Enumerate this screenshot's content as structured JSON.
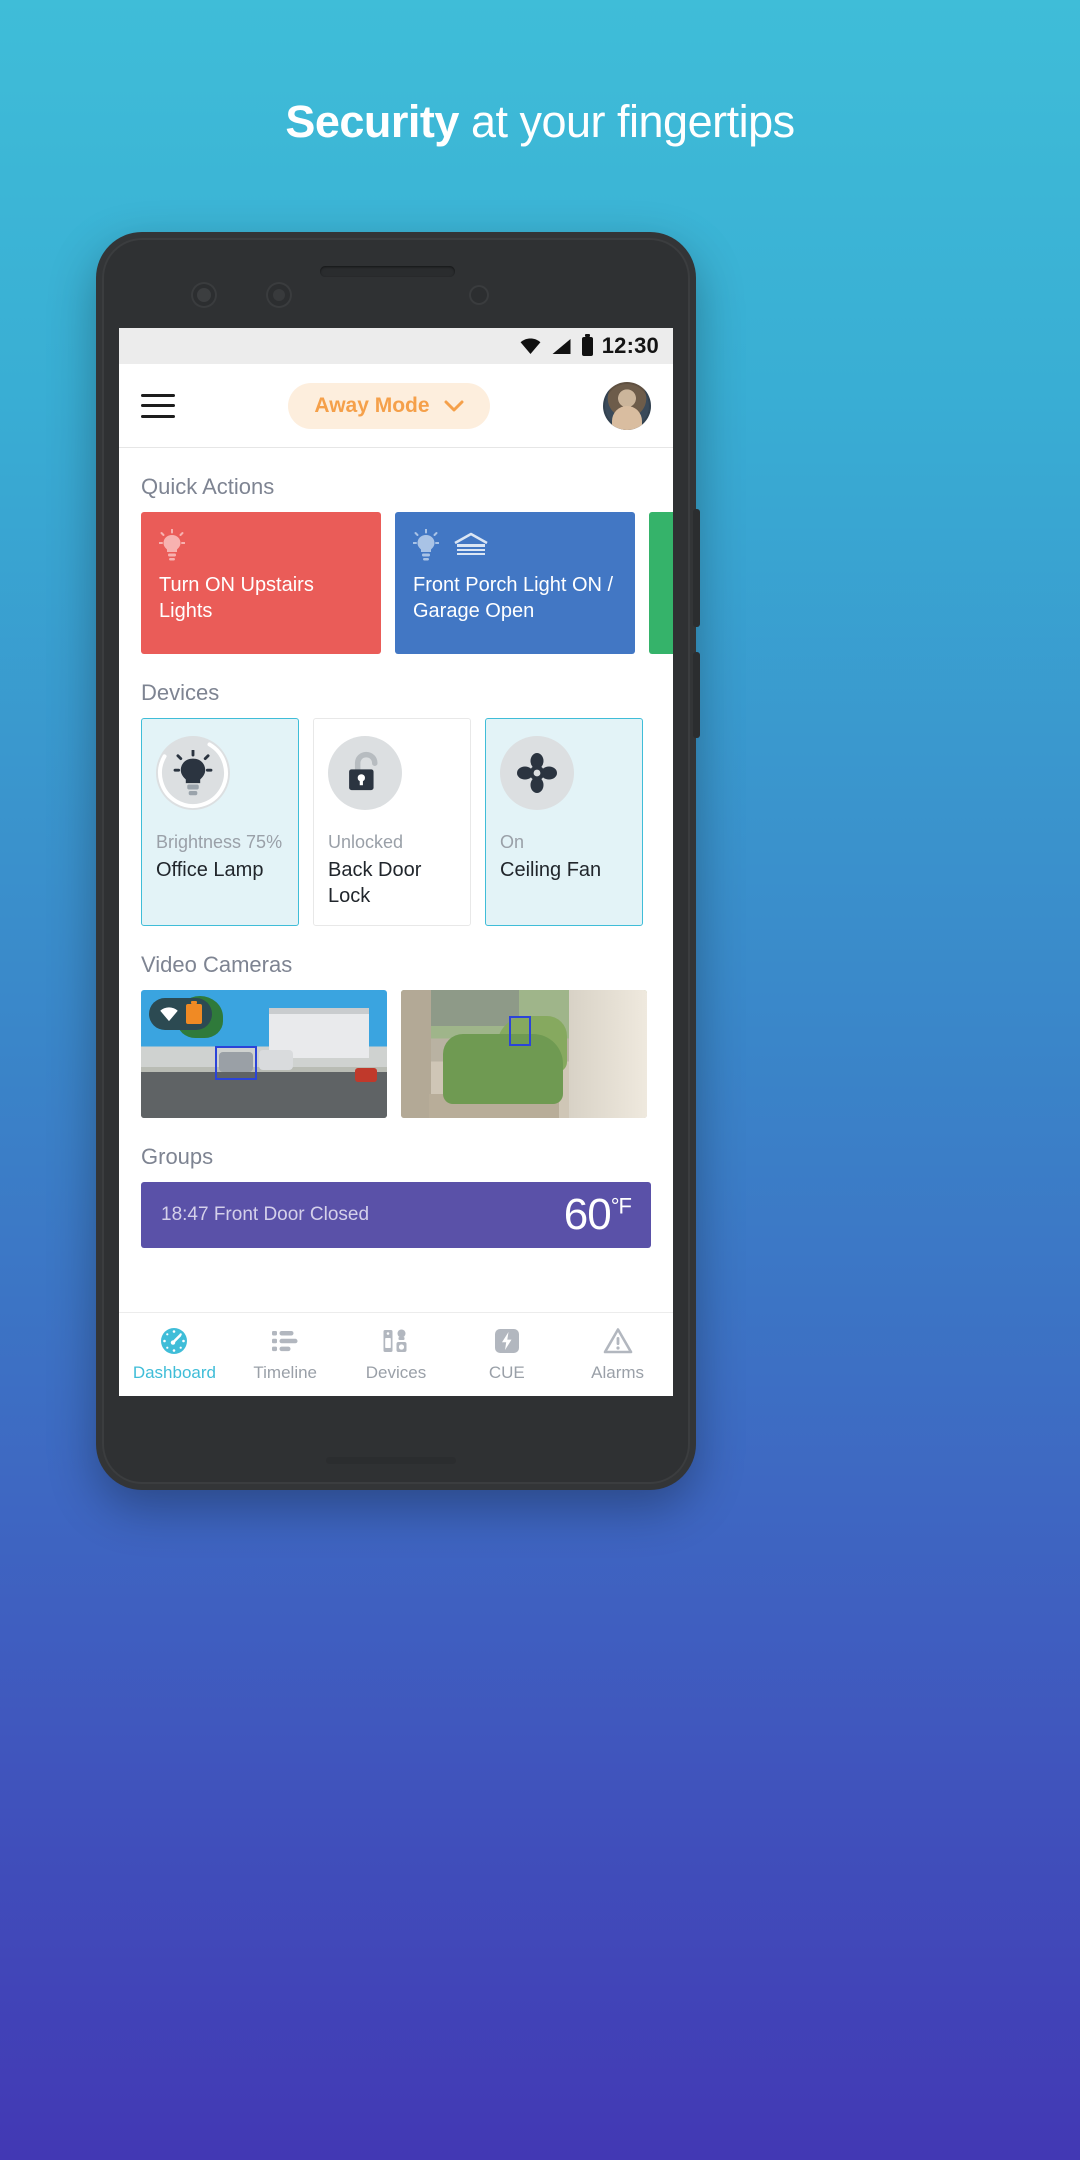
{
  "headline": {
    "bold": "Security",
    "rest": " at your fingertips"
  },
  "statusbar": {
    "clock": "12:30",
    "icons": [
      "wifi-icon",
      "signal-icon",
      "battery-icon"
    ]
  },
  "appbar": {
    "menu_icon": "hamburger-menu-icon",
    "mode_label": "Away Mode",
    "mode_chevron": "chevron-down-icon",
    "avatar": "user-avatar"
  },
  "sections": {
    "quick_actions_title": "Quick Actions",
    "devices_title": "Devices",
    "cameras_title": "Video Cameras",
    "groups_title": "Groups"
  },
  "quick_actions": [
    {
      "label": "Turn ON Upstairs Lights",
      "color": "#ea5c58",
      "icons": [
        "lightbulb-icon"
      ]
    },
    {
      "label": "Front Porch Light ON / Garage Open",
      "color": "#4277c4",
      "icons": [
        "lightbulb-icon",
        "garage-icon"
      ]
    },
    {
      "label": "",
      "color": "#35b36a",
      "icons": []
    }
  ],
  "devices": [
    {
      "state": "Brightness 75%",
      "name": "Office Lamp",
      "icon": "lightbulb-icon",
      "active": true,
      "progress": 75
    },
    {
      "state": "Unlocked",
      "name": "Back Door Lock",
      "icon": "unlocked-padlock-icon",
      "active": false
    },
    {
      "state": "On",
      "name": "Ceiling Fan",
      "icon": "ceiling-fan-icon",
      "active": true
    }
  ],
  "cameras": [
    {
      "name": "driveway-camera",
      "badge_icons": [
        "wifi-icon",
        "battery-icon"
      ]
    },
    {
      "name": "porch-camera",
      "badge_icons": []
    }
  ],
  "groups": {
    "event": "18:47 Front Door Closed",
    "temperature": "60",
    "temperature_unit": "°F"
  },
  "bottom_nav": [
    {
      "label": "Dashboard",
      "icon": "gauge-icon",
      "active": true
    },
    {
      "label": "Timeline",
      "icon": "list-icon",
      "active": false
    },
    {
      "label": "Devices",
      "icon": "devices-icon",
      "active": false
    },
    {
      "label": "CUE",
      "icon": "lightning-bolt-icon",
      "active": false
    },
    {
      "label": "Alarms",
      "icon": "warning-triangle-icon",
      "active": false
    }
  ],
  "android_nav": [
    "back-button",
    "home-button",
    "recents-button"
  ],
  "colors": {
    "accent": "#3fbdd8",
    "mode_orange": "#f5a04a",
    "red_action": "#ea5c58",
    "blue_action": "#4277c4",
    "green_action": "#35b36a",
    "group_purple": "#5a51a8"
  }
}
